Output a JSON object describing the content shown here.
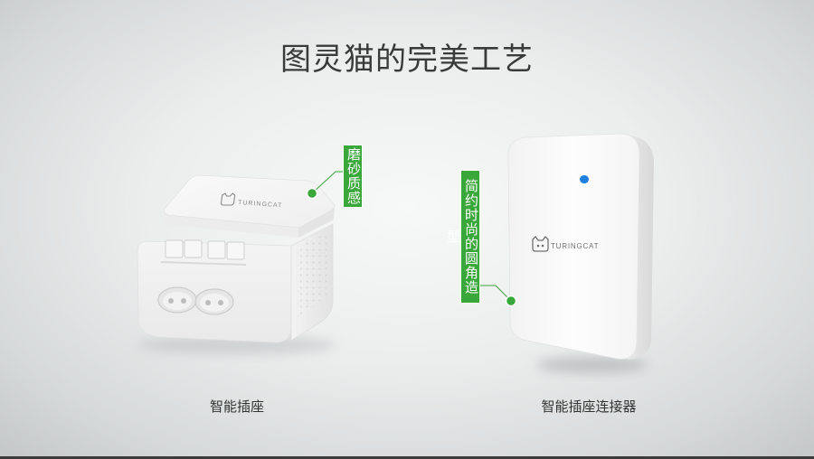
{
  "title": "图灵猫的完美工艺",
  "products": [
    {
      "caption": "智能插座",
      "feature_label": "磨砂质感",
      "logo": "TURINGCAT"
    },
    {
      "caption": "智能插座连接器",
      "feature_label": "简约时尚的圆角造型",
      "logo": "TURINGCAT"
    }
  ],
  "colors": {
    "accent": "#3aa73a",
    "led": "#1e7fe0",
    "title_text": "#3a3a3a"
  },
  "icons": [
    "turingcat-logo-icon",
    "led-indicator",
    "callout-dot"
  ]
}
